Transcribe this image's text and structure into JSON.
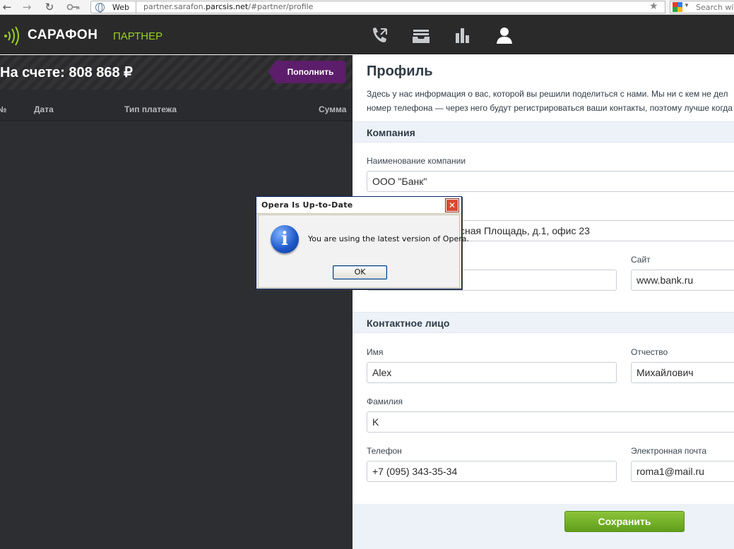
{
  "browser": {
    "search_engine_label": "Web",
    "url_prefix": "partner.sarafon.",
    "url_domain": "parcsis.net",
    "url_suffix": "/#partner/profile",
    "search_placeholder": "Search wit"
  },
  "app": {
    "logo_name": "САРАФОН",
    "logo_sub": "ПАРТНЕР",
    "accent_color": "#9bd021",
    "nav_icons": [
      "phone-icon",
      "inbox-icon",
      "chart-icon",
      "user-icon"
    ]
  },
  "account": {
    "balance_text": "На счете: 808 868 ₽",
    "topup_label": "Пополнить"
  },
  "transactions": {
    "columns": [
      "№",
      "Дата",
      "Тип платежа",
      "Сумма"
    ]
  },
  "profile": {
    "title": "Профиль",
    "intro_line1": "Здесь у нас информация о вас, которой вы решили поделиться с нами. Мы ни с кем не дел",
    "intro_line2": "номер телефона — через него будут регистрироваться ваши контакты, поэтому лучше когда",
    "company_section": "Компания",
    "company_name_label": "Наименование компании",
    "company_name_value": "ООО \"Банк\"",
    "address_value": "сная Площадь, д.1, офис 23",
    "site_label": "Сайт",
    "site_value": "www.bank.ru",
    "contact_section": "Контактное лицо",
    "first_name_label": "Имя",
    "first_name_value": "Alex",
    "patronymic_label": "Отчество",
    "patronymic_value": "Михайлович",
    "last_name_label": "Фамилия",
    "last_name_value": "K",
    "phone_label": "Телефон",
    "phone_value": "+7 (095) 343-35-34",
    "email_label": "Электронная почта",
    "email_value": "roma1@mail.ru",
    "save_label": "Сохранить",
    "save_color": "#6aa824"
  },
  "dialog": {
    "title": "Opera Is Up-to-Date",
    "message": "You are using the latest version of Opera.",
    "ok_label": "OK",
    "close_symbol": "✕",
    "icon_glyph": "i"
  }
}
